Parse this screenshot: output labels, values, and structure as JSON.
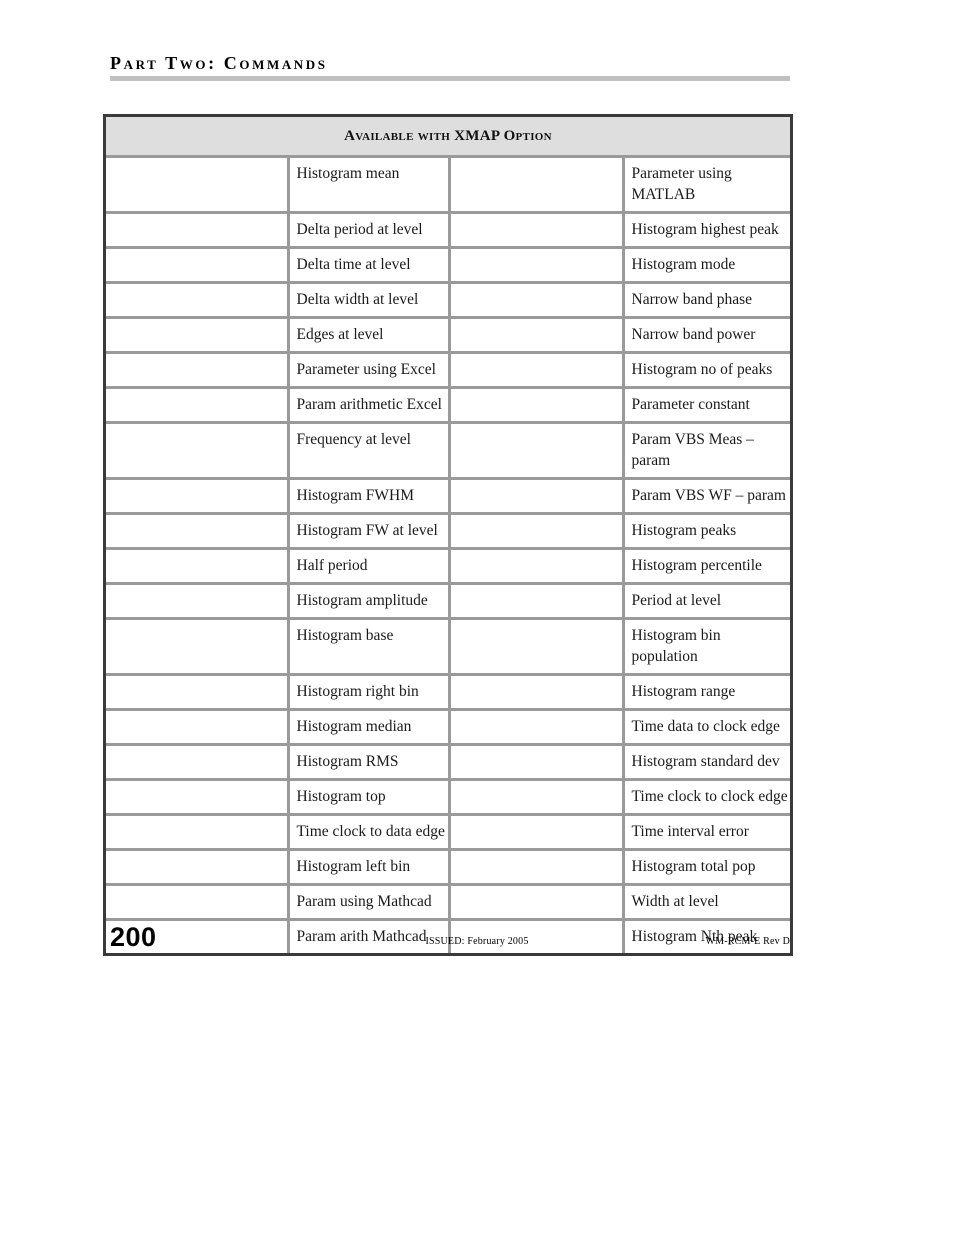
{
  "running_head": {
    "text": "Part Two: Commands"
  },
  "table": {
    "title": "Available with XMAP Option",
    "columns": [
      "",
      "",
      "",
      ""
    ],
    "rows": [
      {
        "col1": "",
        "col2": "Histogram mean",
        "col3": "",
        "col4": "Parameter using MATLAB",
        "tall": true
      },
      {
        "col1": "",
        "col2": "Delta period at level",
        "col3": "",
        "col4": "Histogram highest peak",
        "tall": false
      },
      {
        "col1": "",
        "col2": "Delta time at level",
        "col3": "",
        "col4": "Histogram mode",
        "tall": false
      },
      {
        "col1": "",
        "col2": "Delta width at level",
        "col3": "",
        "col4": "Narrow band phase",
        "tall": false
      },
      {
        "col1": "",
        "col2": "Edges at level",
        "col3": "",
        "col4": "Narrow band power",
        "tall": false
      },
      {
        "col1": "",
        "col2": "Parameter using Excel",
        "col3": "",
        "col4": "Histogram no of peaks",
        "tall": false
      },
      {
        "col1": "",
        "col2": "Param arithmetic Excel",
        "col3": "",
        "col4": "Parameter constant",
        "tall": false
      },
      {
        "col1": "",
        "col2": "Frequency at level",
        "col3": "",
        "col4": "Param VBS Meas – param",
        "tall": true
      },
      {
        "col1": "",
        "col2": "Histogram FWHM",
        "col3": "",
        "col4": "Param VBS WF – param",
        "tall": false
      },
      {
        "col1": "",
        "col2": "Histogram FW at level",
        "col3": "",
        "col4": "Histogram peaks",
        "tall": false
      },
      {
        "col1": "",
        "col2": "Half period",
        "col3": "",
        "col4": "Histogram percentile",
        "tall": false
      },
      {
        "col1": "",
        "col2": "Histogram amplitude",
        "col3": "",
        "col4": "Period at level",
        "tall": false
      },
      {
        "col1": "",
        "col2": "Histogram base",
        "col3": "",
        "col4": "Histogram bin population",
        "tall": true
      },
      {
        "col1": "",
        "col2": "Histogram right bin",
        "col3": "",
        "col4": "Histogram range",
        "tall": false
      },
      {
        "col1": "",
        "col2": "Histogram median",
        "col3": "",
        "col4": "Time data to clock edge",
        "tall": false
      },
      {
        "col1": "",
        "col2": "Histogram RMS",
        "col3": "",
        "col4": "Histogram standard dev",
        "tall": false
      },
      {
        "col1": "",
        "col2": "Histogram top",
        "col3": "",
        "col4": "Time clock to clock edge",
        "tall": false
      },
      {
        "col1": "",
        "col2": "Time clock to data edge",
        "col3": "",
        "col4": "Time interval error",
        "tall": false
      },
      {
        "col1": "",
        "col2": "Histogram left bin",
        "col3": "",
        "col4": "Histogram total pop",
        "tall": false
      },
      {
        "col1": "",
        "col2": "Param using Mathcad",
        "col3": "",
        "col4": "Width at level",
        "tall": false
      },
      {
        "col1": "",
        "col2": "Param arith Mathcad",
        "col3": "",
        "col4": "Histogram Nth peak",
        "tall": false
      }
    ]
  },
  "footer": {
    "page_number": "200",
    "issued": "ISSUED: February 2005",
    "revision": "WM-RCM-E Rev D"
  },
  "colors": {
    "header_fill": "#dedede",
    "inner_border": "#9a9a9a",
    "outer_border": "#3a3a3a",
    "rule": "#c0c0c0"
  }
}
